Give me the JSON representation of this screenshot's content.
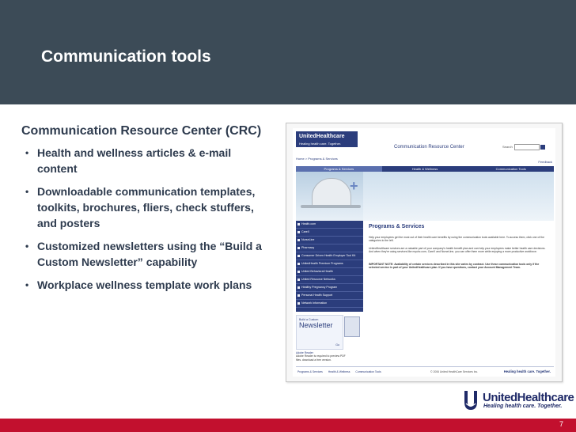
{
  "slide": {
    "title": "Communication tools",
    "page_number": "7",
    "colors": {
      "header_bg": "#3c4b57",
      "accent_red": "#c2102e",
      "text_navy": "#2e3b4e",
      "brand_blue": "#2b3d7c"
    }
  },
  "content": {
    "heading": "Communication Resource Center (CRC)",
    "bullets": [
      "Health and wellness articles & e-mail content",
      "Downloadable communication templates, toolkits, brochures, fliers, check stuffers, and posters",
      "Customized newsletters using the “Build a Custom Newsletter” capability",
      "Workplace wellness template work plans"
    ],
    "bullet_glyph": "•"
  },
  "screenshot": {
    "logo_text": "UnitedHealthcare",
    "logo_tagline": "Healing health care. Together.",
    "site_title": "Communication Resource Center",
    "search_label": "Search",
    "breadcrumb": "Home > Programs & Services",
    "feedback": "Feedback",
    "nav": [
      "Programs & Services",
      "Health & Wellness",
      "Communication Tools"
    ],
    "sidebar": [
      "Health.com",
      "CareX",
      "NurseLine",
      "Pharmacy",
      "Consumer Driven Health Employer Tool Kit",
      "UnitedHealth Premium Programs",
      "United Behavioral Health",
      "United Resource Networks",
      "Healthy Pregnancy Program",
      "Personal Health Support",
      "Network Information"
    ],
    "main_title": "Programs & Services",
    "paragraphs": [
      "Help your employees get the most out of their health care benefits by using the communication tools available here. To access them, click one of the categories to the left.",
      "UnitedHealthcare services are a valuable part of your company's health benefit plan and can help your employees make better health care decisions. And when they're using services like myuhc.com, CareX and NurseLine, you can offer them more while enjoying a more productive workforce.",
      "IMPORTANT NOTE: Availability of certain services described in this site varies by contract. Use these communication tools only if the selected service is part of your UnitedHealthcare plan. If you have questions, contact your Account Management Team."
    ],
    "newsletter": {
      "small": "Build a Custom",
      "big": "Newsletter",
      "go": "Go"
    },
    "adobe": {
      "link": "Adobe Reader",
      "text": "Adobe Reader is required to preview PDF files. download a free version."
    },
    "footer_links": [
      "Programs & Services",
      "Health & Wellness",
      "Communication Tools"
    ],
    "footer_copy": "© 2006 United HealthCare Services Inc.",
    "footer_tagline": "Healing health care. Together."
  },
  "brand": {
    "name": "UnitedHealthcare",
    "tagline": "Healing health care. Together."
  }
}
